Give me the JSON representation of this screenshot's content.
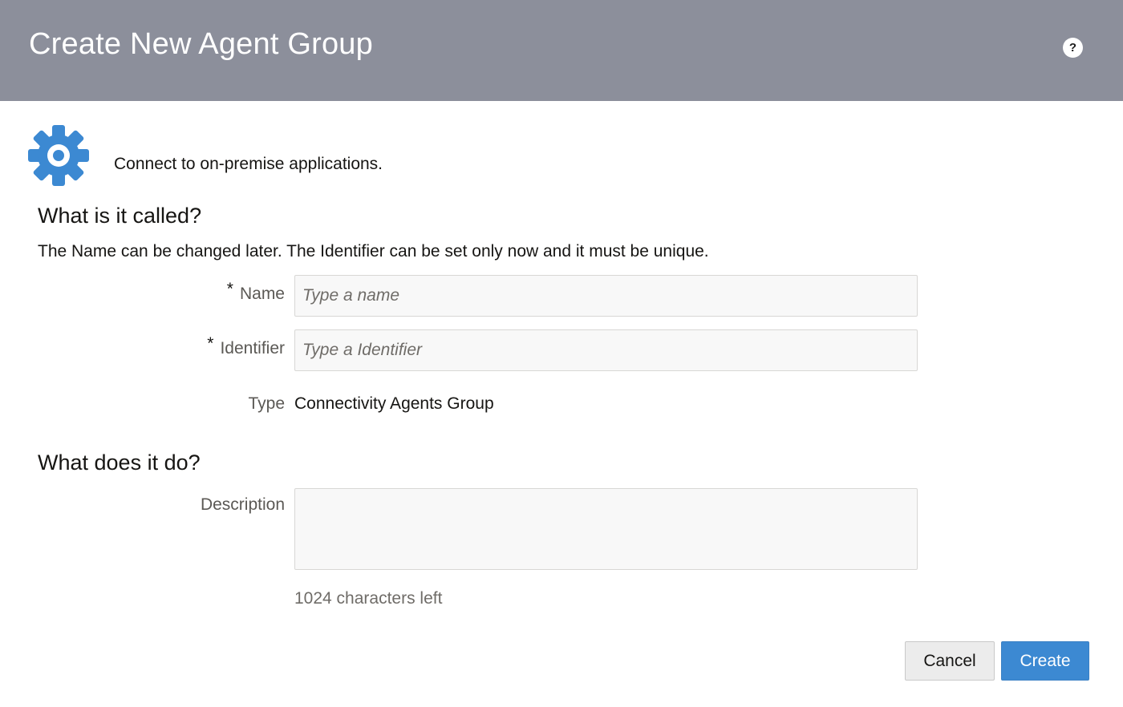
{
  "header": {
    "title": "Create New Agent Group",
    "help_label": "?",
    "background": "#8c8f9b"
  },
  "intro": {
    "icon": "gear-icon",
    "icon_color": "#3c89d2",
    "text": "Connect to on-premise applications."
  },
  "section_called": {
    "title": "What is it called?",
    "hint": "The Name can be changed later. The Identifier can be set only now and it must be unique."
  },
  "fields": {
    "required_marker": "*",
    "name": {
      "label": "Name",
      "value": "",
      "placeholder": "Type a name"
    },
    "identifier": {
      "label": "Identifier",
      "value": "",
      "placeholder": "Type a Identifier"
    },
    "type": {
      "label": "Type",
      "value": "Connectivity Agents Group"
    }
  },
  "section_do": {
    "title": "What does it do?"
  },
  "description": {
    "label": "Description",
    "value": "",
    "chars_left": "1024 characters left"
  },
  "buttons": {
    "cancel": "Cancel",
    "create": "Create",
    "create_color": "#3c89d2"
  }
}
